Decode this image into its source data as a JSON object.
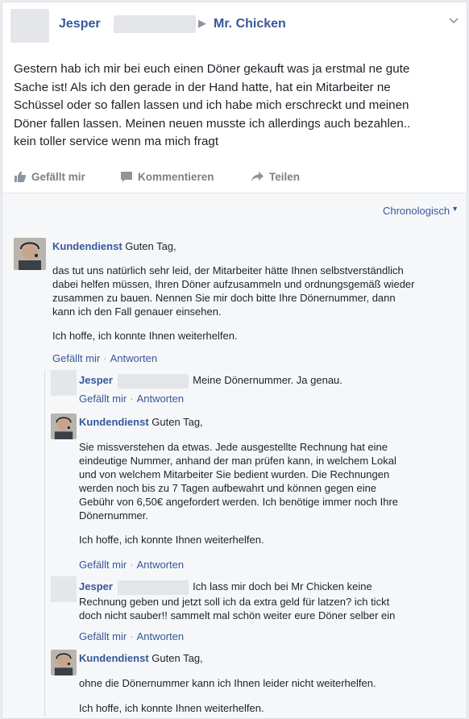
{
  "post": {
    "author": "Jesper",
    "target": "Mr. Chicken",
    "text_lines": [
      "Gestern hab ich mir bei euch einen Döner gekauft was ja erstmal ne gute",
      "Sache ist! Als ich den gerade in der Hand hatte, hat ein Mitarbeiter ne",
      "Schüssel oder so fallen lassen und ich habe mich erschreckt und meinen",
      "Döner fallen lassen. Meinen neuen musste ich allerdings auch bezahlen..",
      "kein toller service wenn ma mich fragt"
    ]
  },
  "actions": {
    "like": "Gefällt mir",
    "comment": "Kommentieren",
    "share": "Teilen"
  },
  "sort_label": "Chronologisch",
  "comments": [
    {
      "name": "Kundendienst",
      "greeting": "Guten Tag,",
      "paragraphs": [
        [
          "das tut uns natürlich sehr leid, der Mitarbeiter hätte Ihnen selbstverständlich",
          "dabei helfen müssen, Ihren Döner aufzusammeln und ordnungsgemäß wieder",
          "zusammen zu bauen. Nennen Sie mir doch bitte Ihre Dönernummer, dann",
          "kann ich den Fall genauer einsehen."
        ],
        [
          "Ich hoffe, ich konnte Ihnen weiterhelfen."
        ]
      ],
      "like": "Gefällt mir",
      "reply": "Antworten"
    },
    {
      "name": "Jesper",
      "text": "Meine Dönernummer. Ja genau.",
      "like": "Gefällt mir",
      "reply": "Antworten"
    },
    {
      "name": "Kundendienst",
      "greeting": "Guten Tag,",
      "paragraphs": [
        [
          "Sie missverstehen da etwas. Jede ausgestellte Rechnung hat eine",
          "eindeutige Nummer, anhand der man prüfen kann, in welchem Lokal",
          "und von welchem Mitarbeiter Sie bedient wurden. Die Rechnungen",
          "werden noch bis zu 7 Tagen aufbewahrt und können gegen eine",
          "Gebühr von 6,50€ angefordert werden. Ich benötige immer noch Ihre",
          "Dönernummer."
        ],
        [
          "Ich hoffe, ich konnte Ihnen weiterhelfen."
        ]
      ],
      "like": "Gefällt mir",
      "reply": "Antworten"
    },
    {
      "name": "Jesper",
      "lines": [
        "Ich lass mir doch bei Mr Chicken keine",
        "Rechnung geben und jetzt soll ich da extra geld für latzen? ich tickt",
        "doch nicht sauber!! sammelt mal schön weiter eure Döner selber ein"
      ],
      "like": "Gefällt mir",
      "reply": "Antworten"
    },
    {
      "name": "Kundendienst",
      "greeting": "Guten Tag,",
      "paragraphs": [
        [
          "ohne die Dönernummer kann ich Ihnen leider nicht weiterhelfen."
        ],
        [
          "Ich hoffe, ich konnte Ihnen weiterhelfen."
        ]
      ]
    }
  ]
}
